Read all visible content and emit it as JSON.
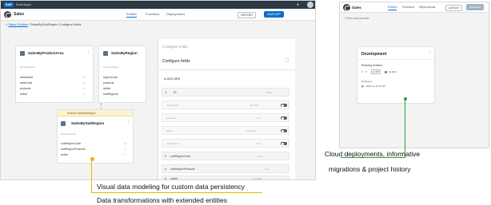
{
  "sap_bar": {
    "logo": "SAP",
    "title": "Build Apps"
  },
  "left_app": {
    "title": "Sales",
    "tabs": [
      {
        "label": "Entities",
        "active": true
      },
      {
        "label": "Functions",
        "active": false
      },
      {
        "label": "Deployments",
        "active": false
      }
    ],
    "history_label": "HISTORY",
    "save_label": "SAVE APP",
    "breadcrumb_link": "Sales Entities",
    "breadcrumb_rest": "/ SalesBySubRegion Configure fields",
    "cards": [
      {
        "title": "SalesByProductArea",
        "desc": "No description",
        "fields": [
          {
            "name": "areaName",
            "type": "Tx"
          },
          {
            "name": "areaCode",
            "type": "Tx"
          },
          {
            "name": "products",
            "type": "[ ]"
          },
          {
            "name": "active",
            "type": "☐"
          }
        ]
      },
      {
        "title": "SalesByRegion",
        "desc": "No description",
        "fields": [
          {
            "name": "regionCode",
            "type": ""
          },
          {
            "name": "products",
            "type": ""
          },
          {
            "name": "active",
            "type": ""
          },
          {
            "name": "subRegions",
            "type": ""
          }
        ]
      },
      {
        "tag": "Extend SalesByRegion",
        "title": "SalesBySubRegion",
        "desc": "No description",
        "fields": [
          {
            "name": "subRegionCode",
            "type": "Tx"
          },
          {
            "name": "subRegionProducts",
            "type": "[ ]"
          },
          {
            "name": "active",
            "type": "☐"
          }
        ]
      }
    ],
    "config": {
      "heading": "Configure entity",
      "subheading": "Configure fields",
      "add_new": "ADD NEW",
      "rows": [
        {
          "name": "ID",
          "type": "UUID"
        },
        {
          "name": "regionCode",
          "type": "Number"
        },
        {
          "name": "products",
          "type": "List"
        },
        {
          "name": "active",
          "type": "True/false"
        },
        {
          "name": "subRegions",
          "type": "List"
        },
        {
          "name": "subRegionCode",
          "type": "Text"
        },
        {
          "name": "subRegionProducts",
          "type": "List"
        },
        {
          "name": "active",
          "type": "True/false"
        }
      ]
    }
  },
  "right_app": {
    "title": "Sales",
    "tabs": [
      {
        "label": "Entities",
        "active": true
      },
      {
        "label": "Functions",
        "active": false
      },
      {
        "label": "Deployments",
        "active": false
      }
    ],
    "history_label": "HISTORY",
    "save_label": "SAVE APP",
    "breadcrumb": "View deployments",
    "deployment": {
      "title": "Development",
      "status": "Running revision",
      "revision": "5",
      "tag": "w/ 567",
      "health": "Healthy",
      "deployed_label": "Deployed",
      "deployed_date": "2022-11-10 15:36"
    }
  },
  "captions": {
    "right": "Cloud deployments, informative",
    "right2": "migrations & project history",
    "left1": "Visual data modeling for custom data persistency",
    "left2": "Data transformations with extended entities"
  },
  "colors": {
    "accent": "#0a6ed1",
    "annotation": "#e6b800",
    "healthy": "#2e9e44"
  }
}
